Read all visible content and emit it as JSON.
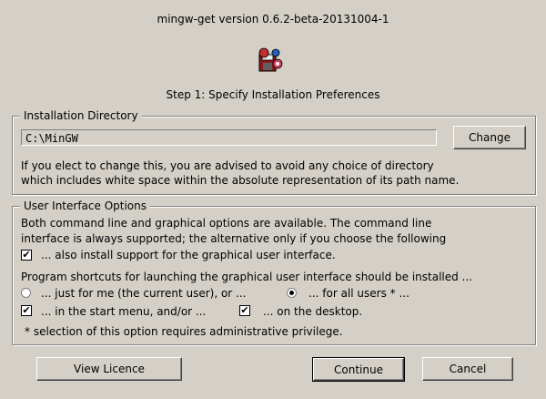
{
  "window": {
    "title": "mingw-get version 0.6.2-beta-20131004-1"
  },
  "step": "Step 1: Specify Installation Preferences",
  "install_dir": {
    "legend": "Installation Directory",
    "path": "C:\\MinGW",
    "change_label": "Change",
    "note_line1": "If you elect to change this, you are advised to avoid any choice of directory",
    "note_line2": "which includes white space within the absolute representation of its path name."
  },
  "ui_options": {
    "legend": "User Interface Options",
    "desc_line1": "Both command line and graphical options are available.  The command line",
    "desc_line2": "interface is always supported; the alternative only if you choose the following",
    "install_gui_label": "... also install support for the graphical user interface.",
    "install_gui_checked": true,
    "shortcuts_label": "Program shortcuts for launching the graphical user interface should be installed ...",
    "just_me_label": "... just for me (the current user), or ...",
    "just_me_selected": false,
    "all_users_label": "... for all users * ...",
    "all_users_selected": true,
    "start_menu_label": "... in the start menu, and/or ...",
    "start_menu_checked": true,
    "desktop_label": "... on the desktop.",
    "desktop_checked": true,
    "admin_note": "*  selection of this option requires administrative privilege."
  },
  "buttons": {
    "view_licence": "View Licence",
    "continue": "Continue",
    "cancel": "Cancel"
  },
  "icons": {
    "logo": "mingw-installer-icon",
    "check": "check-mark-icon"
  }
}
